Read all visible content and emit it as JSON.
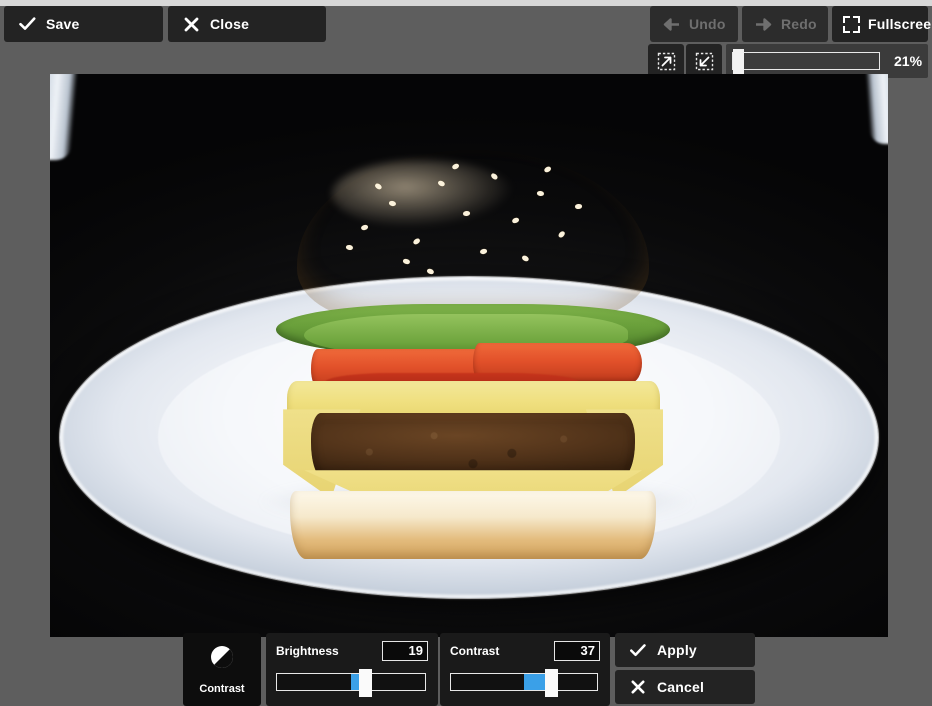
{
  "app": {
    "name": "image-editor",
    "background_color": "#5e5e5e",
    "panel_color": "#232323"
  },
  "toolbar": {
    "save_label": "Save",
    "save_icon": "check-icon",
    "close_label": "Close",
    "close_icon": "x-icon",
    "undo_label": "Undo",
    "undo_icon": "arrow-left-icon",
    "undo_disabled": true,
    "redo_label": "Redo",
    "redo_icon": "arrow-right-icon",
    "redo_disabled": true,
    "fullscreen_label": "Fullscreen",
    "fullscreen_icon": "fullscreen-icon"
  },
  "zoom": {
    "zoom_in_icon": "zoom-in-icon",
    "zoom_out_icon": "zoom-out-icon",
    "value_label": "21%",
    "percent": 21,
    "slider_position_percent": 4
  },
  "canvas": {
    "image_description": "cheeseburger on a white plate against a black background",
    "image_alt": "burger-photo"
  },
  "tools": {
    "active_tool": "Contrast",
    "active_tool_icon": "contrast-icon"
  },
  "adjustments": [
    {
      "id": "brightness",
      "title": "Brightness",
      "value": "19",
      "number": 19,
      "min": -100,
      "max": 100,
      "fill_color": "#3aa0e8"
    },
    {
      "id": "contrast",
      "title": "Contrast",
      "value": "37",
      "number": 37,
      "min": -100,
      "max": 100,
      "fill_color": "#3aa0e8"
    }
  ],
  "actions": {
    "apply_label": "Apply",
    "apply_icon": "check-icon",
    "cancel_label": "Cancel",
    "cancel_icon": "x-icon"
  }
}
